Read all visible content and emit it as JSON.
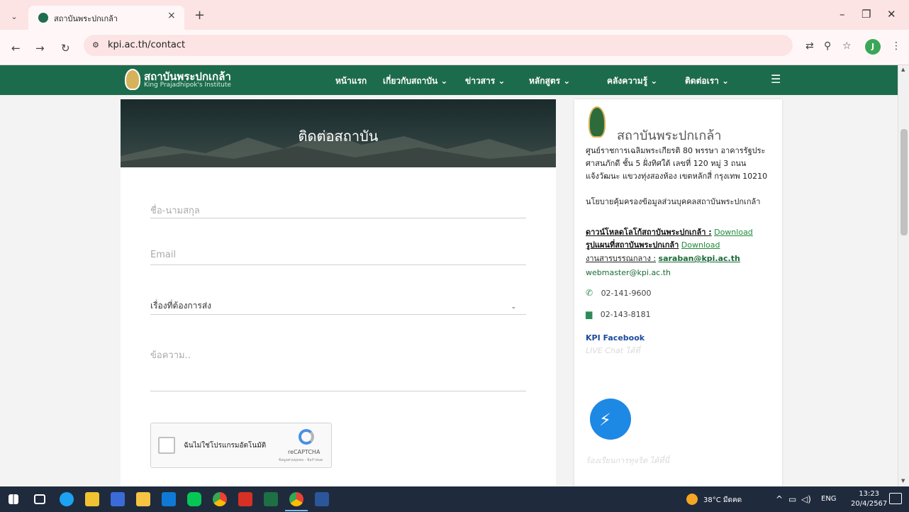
{
  "browser": {
    "tab_title": "สถาบันพระปกเกล้า",
    "url": "kpi.ac.th/contact",
    "avatar_letter": "J",
    "new_tab": "+",
    "tab_close": "×"
  },
  "site": {
    "logo_name": "สถาบันพระปกเกล้า",
    "logo_sub": "King Prajadhipok's Institute",
    "nav": [
      {
        "label": "หน้าแรก"
      },
      {
        "label": "เกี่ยวกับสถาบัน ⌄"
      },
      {
        "label": "ข่าวสาร ⌄"
      },
      {
        "label": "หลักสูตร ⌄"
      },
      {
        "label": "คลังความรู้ ⌄"
      },
      {
        "label": "ติดต่อเรา ⌄"
      }
    ]
  },
  "form": {
    "title": "ติดต่อสถาบัน",
    "name_placeholder": "ชื่อ-นามสกุล",
    "email_placeholder": "Email",
    "subject_value": "เรื่องที่ต้องการส่ง",
    "message_placeholder": "ข้อความ..",
    "captcha_label": "ฉันไม่ใช่โปรแกรมอัตโนมัติ",
    "captcha_brand": "reCAPTCHA",
    "captcha_links": "ข้อมูลส่วนบุคคล - ข้อกำหนด"
  },
  "info": {
    "name": "สถาบันพระปกเกล้า",
    "address": "ศูนย์ราชการเฉลิมพระเกียรติ 80 พรรษา อาคารรัฐประศาสนภักดี ชั้น 5 ฝั่งทิศใต้ เลขที่ 120 หมู่ 3 ถนนแจ้งวัฒนะ แขวงทุ่งสองห้อง เขตหลักสี่ กรุงเทพ 10210",
    "privacy": "นโยบายคุ้มครองข้อมูลส่วนบุคคลสถาบันพระปกเกล้า",
    "logo_download_label": "ดาวน์โหลดโลโก้สถาบันพระปกเกล้า :",
    "map_download_label": "รูปแผนที่สถาบันพระปกเกล้า",
    "download_link": "Download",
    "saraban_label": "งานสารบรรณกลาง :",
    "saraban_email": "saraban@kpi.ac.th",
    "webmaster_email": "webmaster@kpi.ac.th",
    "phone": "02-141-9600",
    "fax": "02-143-8181",
    "facebook": "KPI Facebook",
    "live_chat": "LIVE Chat ได้ที่",
    "complaint": "ร้องเรียนการทุจริต ได้ที่นี่"
  },
  "taskbar": {
    "temperature": "38°C มืดคด",
    "language": "ENG",
    "time": "13:23",
    "date": "20/4/2567"
  },
  "colors": {
    "header_green": "#1d6b4d",
    "link_green": "#1f8a3a",
    "messenger_blue": "#1e88e5"
  }
}
